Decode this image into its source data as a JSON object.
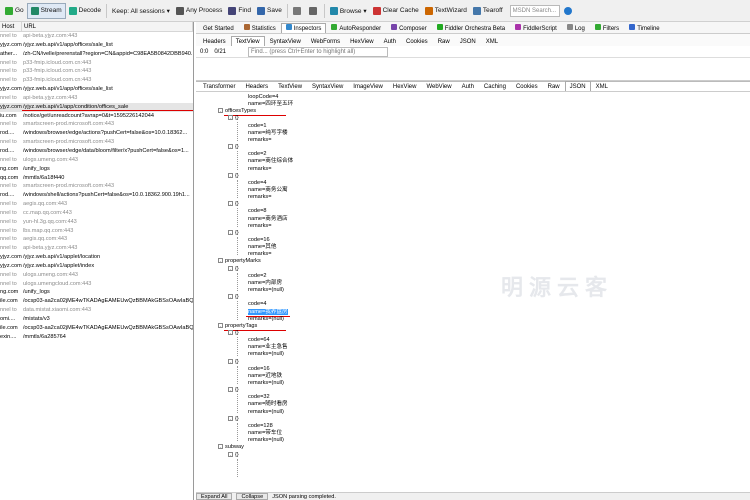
{
  "toolbar": {
    "items": [
      {
        "label": "Go",
        "icon": "go-icon"
      },
      {
        "label": "Stream",
        "icon": "stream-icon"
      },
      {
        "label": "Decode",
        "icon": "decode-icon"
      },
      {
        "label": "Keep: All sessions ▾",
        "icon": ""
      },
      {
        "label": "Any Process",
        "icon": "crosshair-icon"
      },
      {
        "label": "Find",
        "icon": "find-icon"
      },
      {
        "label": "Save",
        "icon": "save-icon"
      },
      {
        "label": "",
        "icon": "camera-icon"
      },
      {
        "label": "",
        "icon": "timer-icon"
      },
      {
        "label": "Browse ▾",
        "icon": "browse-icon"
      },
      {
        "label": "Clear Cache",
        "icon": "clear-cache-icon"
      },
      {
        "label": "TextWizard",
        "icon": "textwizard-icon"
      },
      {
        "label": "Tearoff",
        "icon": "tearoff-icon"
      }
    ],
    "msdn_placeholder": "MSDN Search...",
    "help_icon": "help-icon"
  },
  "sessions": {
    "columns": [
      "Host",
      "URL"
    ],
    "rows": [
      {
        "c1": "nnel to",
        "url": "api-beta.yjyz.com:443",
        "style": "gray"
      },
      {
        "c1": "yjyz.com",
        "url": "/yjyz.web.api/v1/app/offices/sale_list",
        "style": "black"
      },
      {
        "c1": "ather...",
        "url": "/zh-CN/ivelle/prerenstall?region=CN&appid=C98EA5B0842DBB940...",
        "style": "black"
      },
      {
        "c1": "nnel to",
        "url": "p33-fmip.icloud.com.cn:443",
        "style": "gray"
      },
      {
        "c1": "nnel to",
        "url": "p33-fmip.icloud.com.cn:443",
        "style": "gray"
      },
      {
        "c1": "nnel to",
        "url": "p33-fmip.icloud.com.cn:443",
        "style": "gray"
      },
      {
        "c1": "yjyz.com",
        "url": "/yjyz.web.api/v1/app/offices/sale_list",
        "style": "black"
      },
      {
        "c1": "nnel to",
        "url": "api-beta.yjyz.com:443",
        "style": "gray"
      },
      {
        "c1": "yjyz.com",
        "url": "/yjyz.web.api/v1/app/condition/offices_sale",
        "style": "sel"
      },
      {
        "c1": "iu.com",
        "url": "/notice/get/unreadcount?avrap=0&t=1595226142044",
        "style": "black"
      },
      {
        "c1": "nnel to",
        "url": "smartscreen-prod.microsoft.com:443",
        "style": "gray"
      },
      {
        "c1": "rod....",
        "url": "/windows/browser/edge/actions?pushCert=false&os=10.0.18362...",
        "style": "black"
      },
      {
        "c1": "nnel to",
        "url": "smartscreen-prod.microsoft.com:443",
        "style": "gray"
      },
      {
        "c1": "rod....",
        "url": "/windows/browser/edge/data/bloom/filter/x?pushCert=false&os=1...",
        "style": "black"
      },
      {
        "c1": "nnel to",
        "url": "ulogs.umeng.com:443",
        "style": "gray"
      },
      {
        "c1": "ng.com",
        "url": "/unify_logs",
        "style": "black"
      },
      {
        "c1": "qq.com",
        "url": "/mmtls/6a18f440",
        "style": "black"
      },
      {
        "c1": "nnel to",
        "url": "smartscreen-prod.microsoft.com:443",
        "style": "gray"
      },
      {
        "c1": "rod....",
        "url": "/windows/shell/actions?pushCert=false&os=10.0.18362.900.19h1...",
        "style": "black"
      },
      {
        "c1": "nnel to",
        "url": "aegis.qq.com:443",
        "style": "gray"
      },
      {
        "c1": "nnel to",
        "url": "cc.map.qq.com:443",
        "style": "gray"
      },
      {
        "c1": "nnel to",
        "url": "yun-hl.3g.qq.com:443",
        "style": "gray"
      },
      {
        "c1": "nnel to",
        "url": "lbs.map.qq.com:443",
        "style": "gray"
      },
      {
        "c1": "nnel to",
        "url": "aegis.qq.com:443",
        "style": "gray"
      },
      {
        "c1": "nnel to",
        "url": "api-beta.yjyz.com:443",
        "style": "gray"
      },
      {
        "c1": "yjyz.com",
        "url": "/yjyz.web.api/v1/applet/location",
        "style": "black"
      },
      {
        "c1": "yjyz.com",
        "url": "/yjyz.web.api/v1/applet/index",
        "style": "black"
      },
      {
        "c1": "nnel to",
        "url": "ulogs.umeng.com:443",
        "style": "gray"
      },
      {
        "c1": "nnel to",
        "url": "ulogs.umengcloud.com:443",
        "style": "gray"
      },
      {
        "c1": "ng.com",
        "url": "/unify_logs",
        "style": "black"
      },
      {
        "c1": "ile.com",
        "url": "/ocsp03-aa2ca02jME4wTKADAgEAMEUwQzBBMAkGBSsOAwIaBQAE...",
        "style": "black"
      },
      {
        "c1": "nnel to",
        "url": "data.mistat.xiaomi.com:443",
        "style": "gray"
      },
      {
        "c1": "omi....",
        "url": "/mistats/v3",
        "style": "black"
      },
      {
        "c1": "ile.com",
        "url": "/ocsp03-aa2ca02jME4wTKADAgEAMEUwQzBBMAkGBSsOAwIaBQAE...",
        "style": "black"
      },
      {
        "c1": "exin....",
        "url": "/mmtls/6a285764",
        "style": "black"
      }
    ]
  },
  "inspector_tabs": [
    {
      "label": "Get Started",
      "icon": ""
    },
    {
      "label": "Statistics",
      "icon": "statistics-icon"
    },
    {
      "label": "Inspectors",
      "icon": "inspectors-icon",
      "active": true
    },
    {
      "label": "AutoResponder",
      "icon": "autoresponder-icon"
    },
    {
      "label": "Composer",
      "icon": "composer-icon"
    },
    {
      "label": "Fiddler Orchestra Beta",
      "icon": "orchestra-icon"
    },
    {
      "label": "FiddlerScript",
      "icon": "script-icon"
    },
    {
      "label": "Log",
      "icon": "log-icon"
    },
    {
      "label": "Filters",
      "icon": "filters-icon"
    },
    {
      "label": "Timeline",
      "icon": "timeline-icon"
    }
  ],
  "request_tabs": [
    "Headers",
    "TextView",
    "SyntaxView",
    "WebForms",
    "HexView",
    "Auth",
    "Cookies",
    "Raw",
    "JSON",
    "XML"
  ],
  "request_active": "TextView",
  "findbar": {
    "pos": "0:0",
    "count": "0/21",
    "placeholder": "Find... (press Ctrl+Enter to highlight all)"
  },
  "response_tabs": [
    "Transformer",
    "Headers",
    "TextView",
    "SyntaxView",
    "ImageView",
    "HexView",
    "WebView",
    "Auth",
    "Caching",
    "Cookies",
    "Raw",
    "JSON",
    "XML"
  ],
  "response_active": "JSON",
  "tree": [
    {
      "t": "loopCode=4",
      "lv": 4
    },
    {
      "t": "name=四环至五环",
      "lv": 4
    },
    {
      "t": "officesTypes",
      "lv": 1,
      "exp": "-",
      "red": true
    },
    {
      "t": "{}",
      "lv": 2,
      "exp": "-"
    },
    {
      "t": "code=1",
      "lv": 4
    },
    {
      "t": "name=纯写字楼",
      "lv": 4
    },
    {
      "t": "remarks=",
      "lv": 4
    },
    {
      "t": "{}",
      "lv": 2,
      "exp": "-"
    },
    {
      "t": "code=2",
      "lv": 4
    },
    {
      "t": "name=商住综合体",
      "lv": 4
    },
    {
      "t": "remarks=",
      "lv": 4
    },
    {
      "t": "{}",
      "lv": 2,
      "exp": "-"
    },
    {
      "t": "code=4",
      "lv": 4
    },
    {
      "t": "name=商务公寓",
      "lv": 4
    },
    {
      "t": "remarks=",
      "lv": 4
    },
    {
      "t": "{}",
      "lv": 2,
      "exp": "-"
    },
    {
      "t": "code=8",
      "lv": 4
    },
    {
      "t": "name=商务酒店",
      "lv": 4
    },
    {
      "t": "remarks=",
      "lv": 4
    },
    {
      "t": "{}",
      "lv": 2,
      "exp": "-"
    },
    {
      "t": "code=16",
      "lv": 4
    },
    {
      "t": "name=其他",
      "lv": 4
    },
    {
      "t": "remarks=",
      "lv": 4
    },
    {
      "t": "propertyMarks",
      "lv": 1,
      "exp": "-"
    },
    {
      "t": "{}",
      "lv": 2,
      "exp": "-"
    },
    {
      "t": "code=2",
      "lv": 4
    },
    {
      "t": "name=内部房",
      "lv": 4
    },
    {
      "t": "remarks=(null)",
      "lv": 4
    },
    {
      "t": "{}",
      "lv": 2,
      "exp": "-"
    },
    {
      "t": "code=4",
      "lv": 4
    },
    {
      "t": "name=我养盘房",
      "lv": 4,
      "hl": true
    },
    {
      "t": "remarks=(null)",
      "lv": 4
    },
    {
      "t": "propertyTags",
      "lv": 1,
      "exp": "-",
      "red": true
    },
    {
      "t": "{}",
      "lv": 2,
      "exp": "-"
    },
    {
      "t": "code=64",
      "lv": 4
    },
    {
      "t": "name=业主急售",
      "lv": 4
    },
    {
      "t": "remarks=(null)",
      "lv": 4
    },
    {
      "t": "{}",
      "lv": 2,
      "exp": "-"
    },
    {
      "t": "code=16",
      "lv": 4
    },
    {
      "t": "name=近地铁",
      "lv": 4
    },
    {
      "t": "remarks=(null)",
      "lv": 4
    },
    {
      "t": "{}",
      "lv": 2,
      "exp": "-"
    },
    {
      "t": "code=32",
      "lv": 4
    },
    {
      "t": "name=随时看房",
      "lv": 4
    },
    {
      "t": "remarks=(null)",
      "lv": 4
    },
    {
      "t": "{}",
      "lv": 2,
      "exp": "-"
    },
    {
      "t": "code=128",
      "lv": 4
    },
    {
      "t": "name=带车位",
      "lv": 4
    },
    {
      "t": "remarks=(null)",
      "lv": 4
    },
    {
      "t": "subway",
      "lv": 1,
      "exp": "-"
    },
    {
      "t": "{}",
      "lv": 2,
      "exp": "-"
    }
  ],
  "statusbar": {
    "expand": "Expand All",
    "collapse": "Collapse",
    "message": "JSON parsing completed."
  },
  "watermark": "明源云客"
}
